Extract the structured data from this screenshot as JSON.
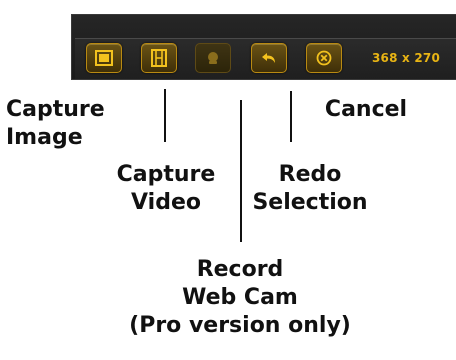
{
  "toolbar": {
    "buttons": [
      {
        "icon": "capture-image-icon",
        "enabled": true
      },
      {
        "icon": "film-icon",
        "enabled": true
      },
      {
        "icon": "webcam-icon",
        "enabled": false
      },
      {
        "icon": "undo-arrow-icon",
        "enabled": true
      },
      {
        "icon": "cancel-x-icon",
        "enabled": true
      }
    ],
    "size_readout": "368 x 270",
    "accent_color": "#e8b414"
  },
  "labels": {
    "capture_image": [
      "Capture",
      "Image"
    ],
    "capture_video": [
      "Capture",
      "Video"
    ],
    "record_webcam": [
      "Record",
      "Web Cam",
      "(Pro version only)"
    ],
    "redo_selection": [
      "Redo",
      "Selection"
    ],
    "cancel": [
      "Cancel"
    ]
  }
}
